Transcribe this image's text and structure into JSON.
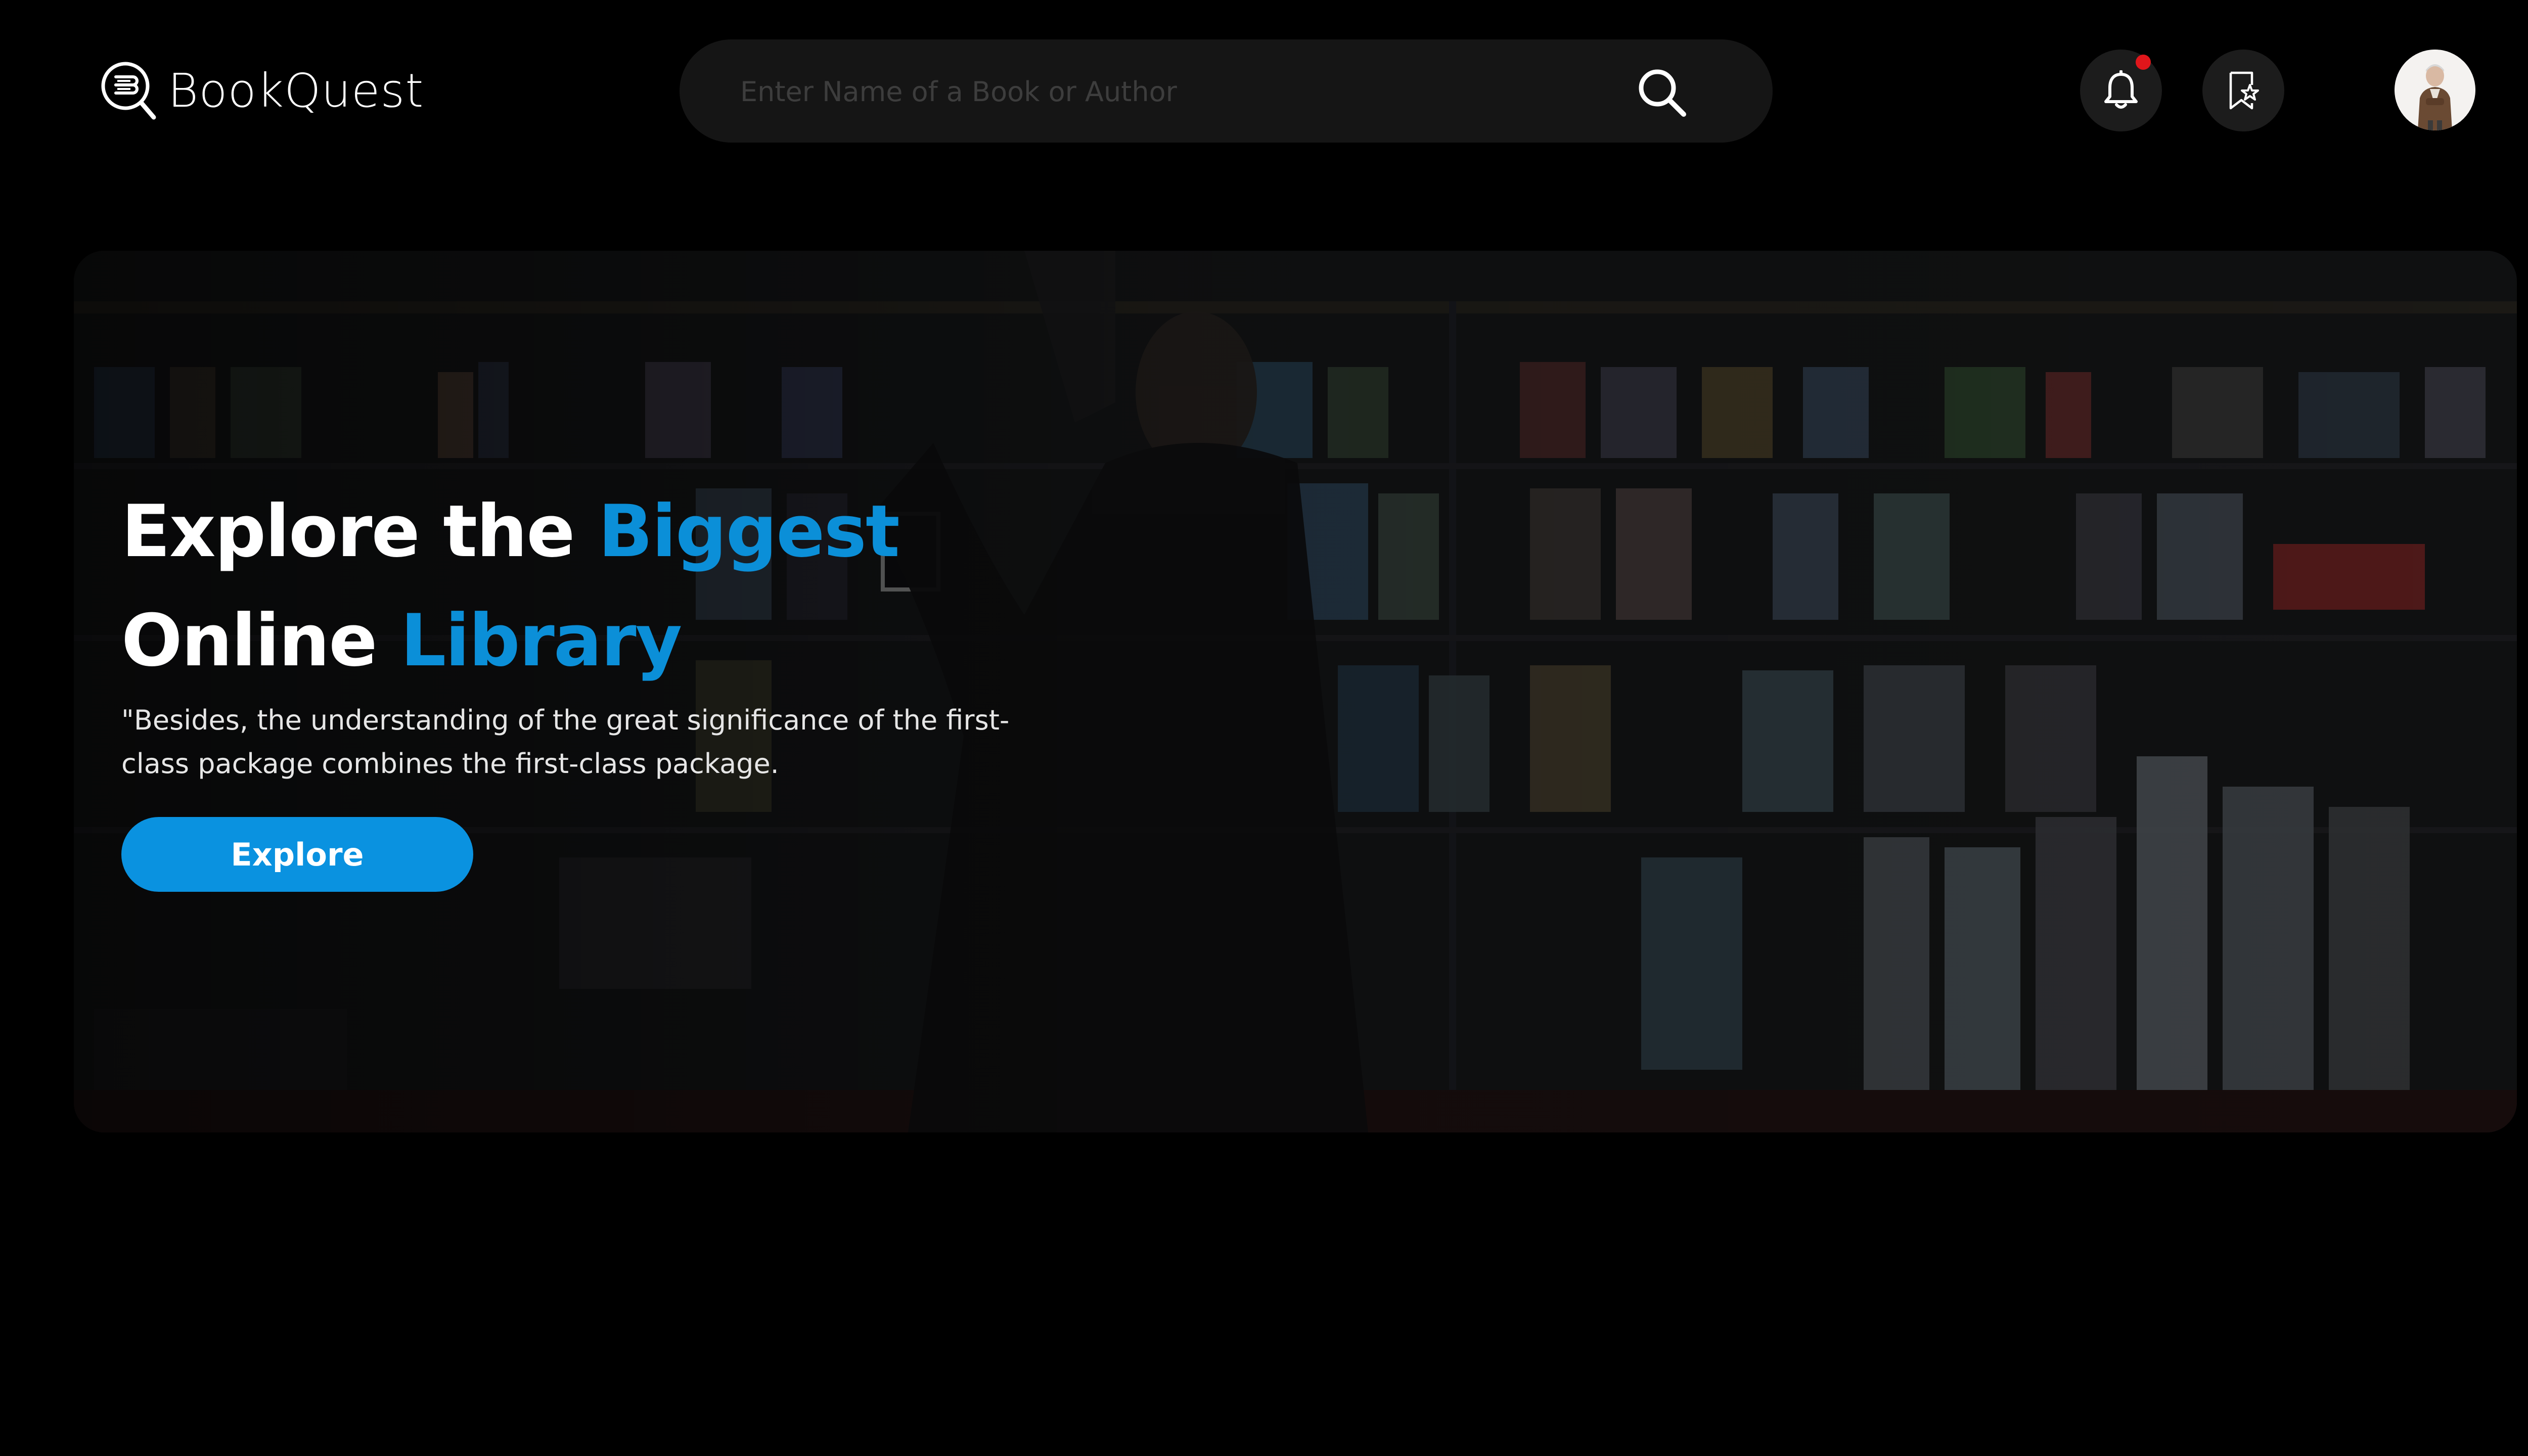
{
  "app": {
    "name": "BookQuest"
  },
  "header": {
    "search": {
      "placeholder": "Enter Name of a Book or Author",
      "value": "",
      "icon": "search-icon"
    },
    "notifications": {
      "icon": "bell-icon",
      "has_unread": true
    },
    "bookmarks": {
      "icon": "bookmark-star-icon"
    },
    "avatar": {
      "icon": "user-avatar"
    }
  },
  "hero": {
    "title_line1_plain": "Explore the ",
    "title_line1_accent": "Biggest",
    "title_line2_plain": "Online ",
    "title_line2_accent": "Library",
    "description": "\"Besides, the understanding of the great significance of the first-class package combines the first-class package.",
    "button_label": "Explore"
  },
  "colors": {
    "background": "#000000",
    "accent": "#0b8fd8",
    "button": "#0a92e0",
    "notification_dot": "#e0161b",
    "surface": "#1c1c1c"
  }
}
